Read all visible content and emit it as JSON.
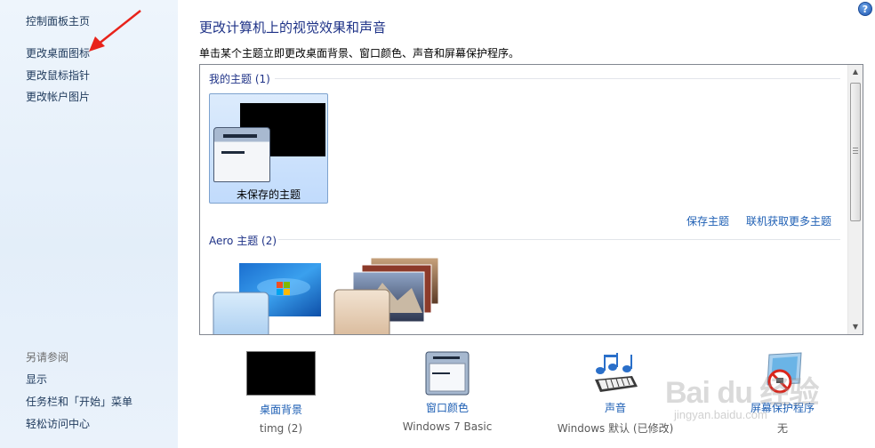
{
  "left_pane": {
    "items": [
      {
        "label": "控制面板主页"
      },
      {
        "label": "更改桌面图标"
      },
      {
        "label": "更改鼠标指针"
      },
      {
        "label": "更改帐户图片"
      }
    ],
    "see_also_heading": "另请参阅",
    "see_also_items": [
      {
        "label": "显示"
      },
      {
        "label": "任务栏和「开始」菜单"
      },
      {
        "label": "轻松访问中心"
      }
    ]
  },
  "header": {
    "title": "更改计算机上的视觉效果和声音",
    "subtitle": "单击某个主题立即更改桌面背景、窗口颜色、声音和屏幕保护程序。",
    "help_label": "?"
  },
  "themes": {
    "my_themes_header": "我的主题 (1)",
    "unsaved_theme_label": "未保存的主题",
    "save_theme_link": "保存主题",
    "get_more_link": "联机获取更多主题",
    "aero_header": "Aero 主题 (2)"
  },
  "bottom": {
    "desktop_background": {
      "title": "桌面背景",
      "value": "timg (2)"
    },
    "window_color": {
      "title": "窗口颜色",
      "value": "Windows 7 Basic"
    },
    "sounds": {
      "title": "声音",
      "value": "Windows 默认 (已修改)"
    },
    "screen_saver": {
      "title": "屏幕保护程序",
      "value": "无"
    }
  },
  "watermark": {
    "main": "Bai du 经验",
    "sub": "jingyan.baidu.com"
  },
  "colors": {
    "left_pane_bg": "#e8f1fb",
    "title_blue": "#1e3287",
    "link_blue": "#1e5fb4",
    "selection": "#c9e0fb"
  },
  "icons": {
    "help": "help-icon",
    "arrow": "red-arrow-annotation",
    "sound": "music-notes-icon",
    "screensaver": "screensaver-icon"
  }
}
